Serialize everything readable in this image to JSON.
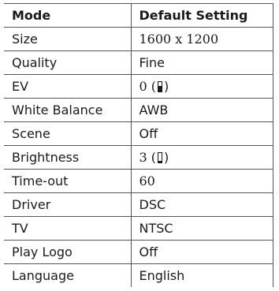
{
  "table": {
    "header": {
      "mode": "Mode",
      "default": "Default Setting"
    },
    "rows": [
      {
        "mode": "Size",
        "value": "1600 x 1200"
      },
      {
        "mode": "Quality",
        "value": "Fine"
      },
      {
        "mode": "EV",
        "value_prefix": "0 (",
        "value_suffix": ")",
        "level_icon": "slider-level-icon",
        "level_fraction": 0.6
      },
      {
        "mode": "White Balance",
        "value": "AWB"
      },
      {
        "mode": "Scene",
        "value": "Off"
      },
      {
        "mode": "Brightness",
        "value_prefix": "3 (",
        "value_suffix": ")",
        "level_icon": "slider-level-icon",
        "level_fraction": 0.2
      },
      {
        "mode": "Time-out",
        "value": "60"
      },
      {
        "mode": "Driver",
        "value": "DSC"
      },
      {
        "mode": "TV",
        "value": "NTSC"
      },
      {
        "mode": "Play Logo",
        "value": "Off"
      },
      {
        "mode": "Language",
        "value": "English"
      }
    ]
  }
}
